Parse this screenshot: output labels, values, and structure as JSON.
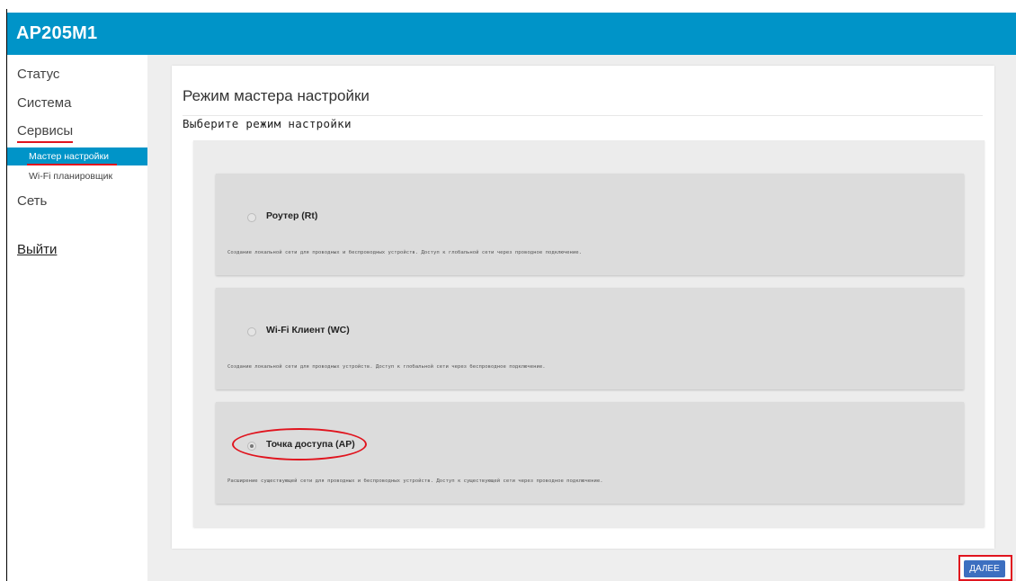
{
  "app": {
    "title": "AP205M1"
  },
  "sidebar": {
    "items": [
      {
        "label": "Статус"
      },
      {
        "label": "Система"
      },
      {
        "label": "Сервисы"
      },
      {
        "label": "Сеть"
      }
    ],
    "subitems": [
      {
        "label": "Мастер настройки",
        "active": true
      },
      {
        "label": "Wi-Fi планировщик",
        "active": false
      }
    ],
    "logout": "Выйти"
  },
  "wizard": {
    "title": "Режим мастера настройки",
    "subtitle": "Выберите режим настройки",
    "modes": [
      {
        "label": "Роутер (Rt)",
        "description": "Создание локальной сети для проводных и беспроводных устройств. Доступ к глобальной сети через проводное подключение.",
        "selected": false
      },
      {
        "label": "Wi-Fi Клиент (WC)",
        "description": "Создание локальной сети для проводных устройств. Доступ к глобальной сети через беспроводное подключение.",
        "selected": false
      },
      {
        "label": "Точка доступа (AP)",
        "description": "Расширение существующей сети для проводных и беспроводных устройств. Доступ к существующей сети через проводное подключение.",
        "selected": true
      }
    ],
    "next_label": "ДАЛЕЕ"
  },
  "colors": {
    "header": "#0094c8",
    "active_nav": "#0094c8",
    "button": "#3c6fc0",
    "highlight": "#e0141e"
  }
}
